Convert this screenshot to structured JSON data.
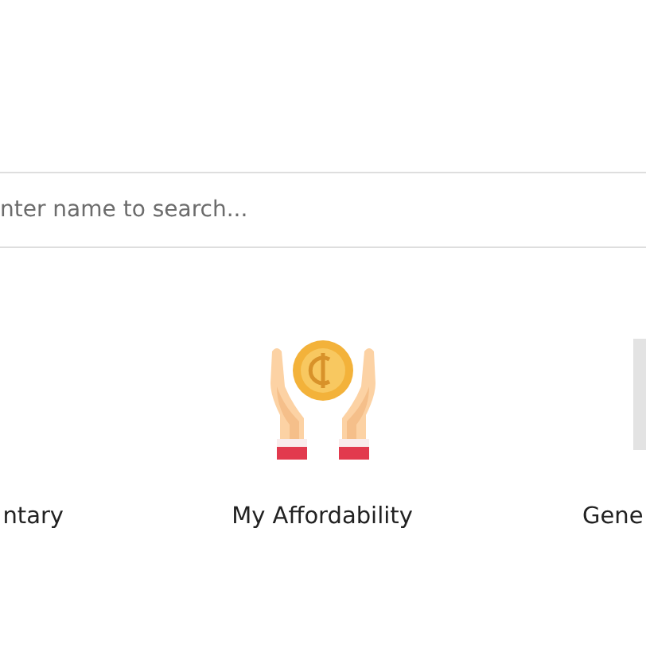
{
  "search": {
    "placeholder": "nter name to search..."
  },
  "tiles": [
    {
      "label": "ntary",
      "kind": "partial-left"
    },
    {
      "label": "My Affordability",
      "kind": "hands-coin"
    },
    {
      "label": "Gene",
      "kind": "partial-right"
    }
  ]
}
